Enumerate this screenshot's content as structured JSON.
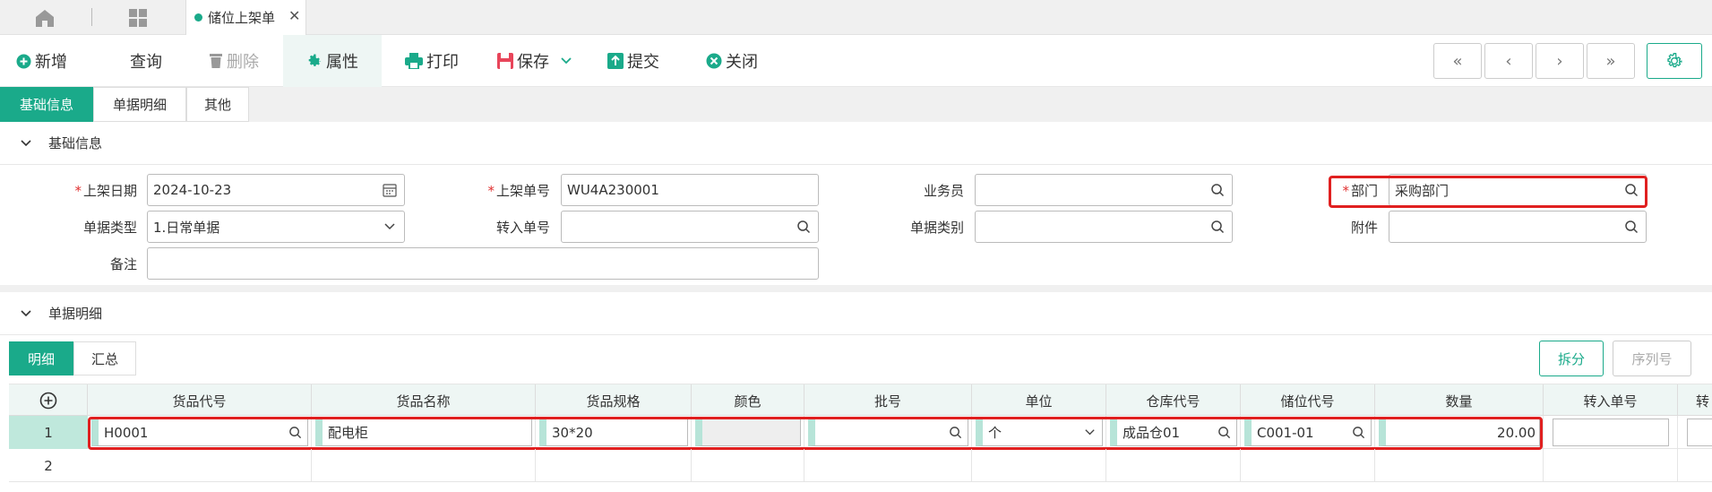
{
  "top_tabs": {
    "doc_tab_label": "储位上架单",
    "close_glyph": "✕"
  },
  "toolbar": {
    "new": "新增",
    "query": "查询",
    "delete": "删除",
    "properties": "属性",
    "print": "打印",
    "save": "保存",
    "submit": "提交",
    "close": "关闭",
    "nav_first": "«",
    "nav_prev": "‹",
    "nav_next": "›",
    "nav_last": "»"
  },
  "section_tabs": [
    "基础信息",
    "单据明细",
    "其他"
  ],
  "basic_info": {
    "title": "基础信息",
    "shelf_date_label": "上架日期",
    "shelf_date": "2024-10-23",
    "shelf_no_label": "上架单号",
    "shelf_no": "WU4A230001",
    "salesman_label": "业务员",
    "salesman": "",
    "dept_label": "部门",
    "dept": "采购部门",
    "doc_type_label": "单据类型",
    "doc_type": "1.日常单据",
    "transfer_no_label": "转入单号",
    "transfer_no": "",
    "doc_category_label": "单据类别",
    "doc_category": "",
    "attachment_label": "附件",
    "attachment": "",
    "remark_label": "备注",
    "remark": ""
  },
  "detail": {
    "title": "单据明细",
    "subtabs": [
      "明细",
      "汇总"
    ],
    "split_button": "拆分",
    "serial_button": "序列号",
    "columns": [
      "货品代号",
      "货品名称",
      "货品规格",
      "颜色",
      "批号",
      "单位",
      "仓库代号",
      "储位代号",
      "数量",
      "转入单号",
      "转"
    ],
    "rows": [
      {
        "num": "1",
        "item_code": "H0001",
        "item_name": "配电柜",
        "spec": "30*20",
        "color": "",
        "batch": "",
        "unit": "个",
        "warehouse": "成品仓01",
        "location": "C001-01",
        "qty": "20.00",
        "transfer": ""
      },
      {
        "num": "2"
      }
    ]
  },
  "colors": {
    "accent": "#1aaa8a",
    "highlight_border": "#e02020",
    "required": "#e03030"
  }
}
